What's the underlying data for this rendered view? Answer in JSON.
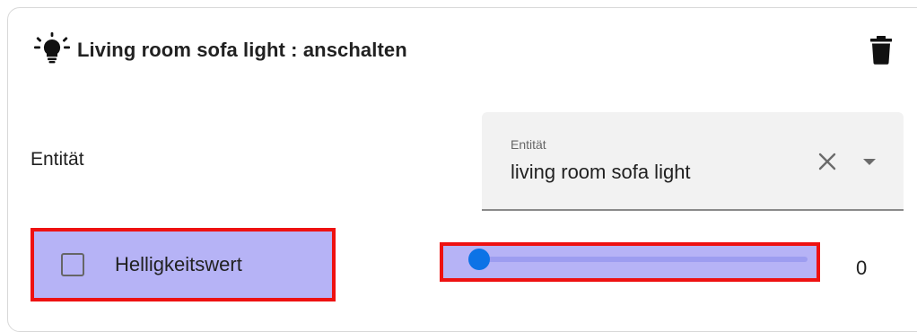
{
  "action": {
    "title": "Living room sofa light : anschalten",
    "icon": "lightbulb-on-icon",
    "delete_icon": "trash-icon"
  },
  "entity_row": {
    "label": "Entität",
    "select": {
      "floating_label": "Entität",
      "value": "living room sofa light",
      "clear_icon": "close-icon",
      "dropdown_icon": "chevron-down-icon"
    }
  },
  "brightness": {
    "checkbox_label": "Helligkeitswert",
    "checked": false,
    "slider_value": 0,
    "slider_display": "0"
  },
  "colors": {
    "highlight": "#b6b3f6",
    "highlight_border": "#ee1111",
    "slider_accent": "#1e88e5"
  }
}
